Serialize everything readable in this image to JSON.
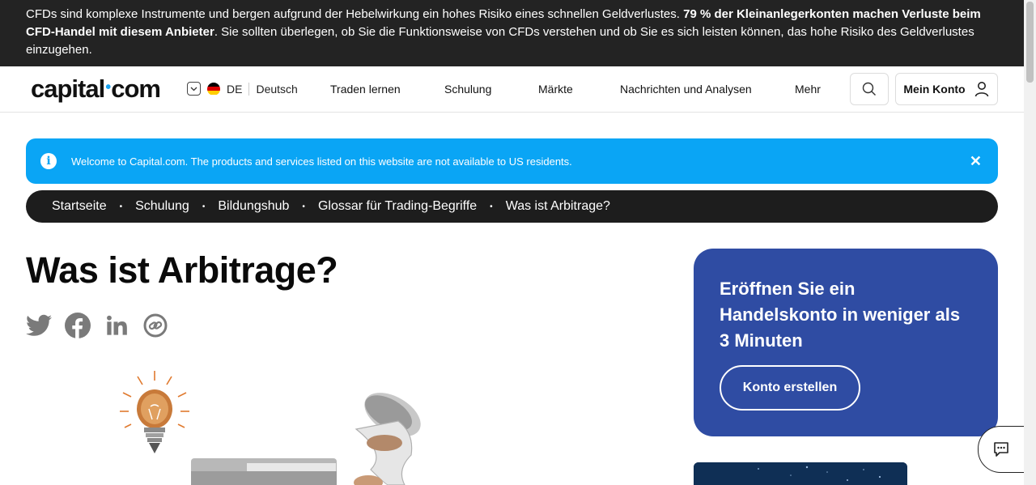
{
  "risk_banner": {
    "text_normal": "CFDs sind komplexe Instrumente und bergen aufgrund der Hebelwirkung ein hohes Risiko eines schnellen Geldverlustes. ",
    "text_bold": "79 % der Kleinanlegerkonten machen Verluste beim CFD-Handel mit diesem Anbieter",
    "text_tail": ". Sie sollten überlegen, ob Sie die Funktionsweise von CFDs verstehen und ob Sie es sich leisten können, das hohe Risiko des Geldverlustes einzugehen."
  },
  "header": {
    "logo_left": "capital",
    "logo_dot": "•",
    "logo_right": "com",
    "lang_code": "DE",
    "lang_name": "Deutsch",
    "nav": [
      "Traden lernen",
      "Schulung",
      "Märkte",
      "Nachrichten und Analysen",
      "Mehr"
    ],
    "account_label": "Mein Konto"
  },
  "notice": {
    "icon": "i",
    "text": "Welcome to Capital.com. The products and services listed on this website are not available to US residents.",
    "close": "✕"
  },
  "breadcrumb": {
    "items": [
      "Startseite",
      "Schulung",
      "Bildungshub",
      "Glossar für Trading-Begriffe",
      "Was ist Arbitrage?"
    ],
    "separator": "•"
  },
  "page_title": "Was ist Arbitrage?",
  "share_icons": [
    "twitter-icon",
    "facebook-icon",
    "linkedin-icon",
    "copy-link-icon"
  ],
  "cta": {
    "heading": "Eröffnen Sie ein Handelskonto in weniger als 3 Minuten",
    "button": "Konto erstellen"
  },
  "colors": {
    "banner_bg": "#232323",
    "notice_bg": "#0aa5f5",
    "breadcrumb_bg": "#1d1d1d",
    "cta_bg": "#2f4ca3",
    "logo_dot": "#1aa2f0"
  }
}
